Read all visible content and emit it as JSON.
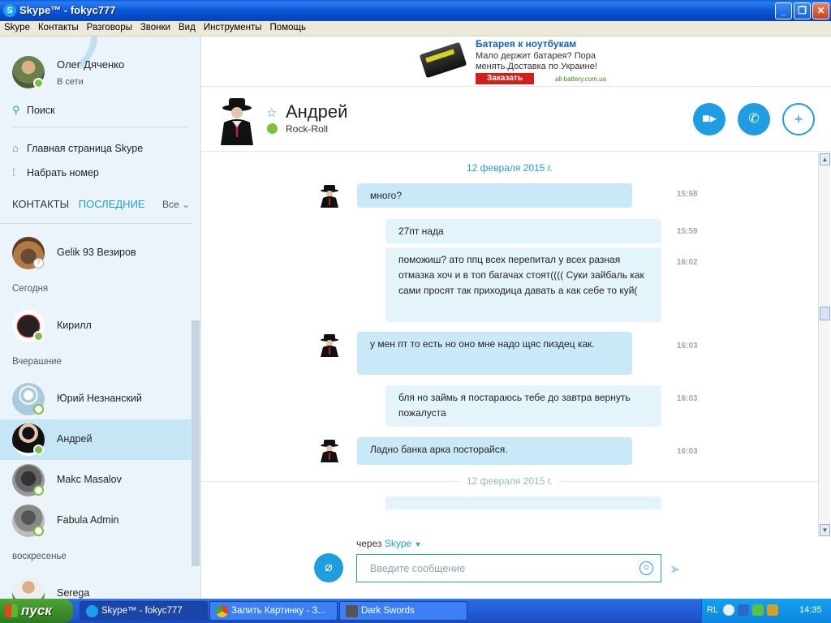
{
  "window": {
    "title": "Skype™ - fokyc777",
    "app_icon": "S"
  },
  "menu": [
    "Skype",
    "Контакты",
    "Разговоры",
    "Звонки",
    "Вид",
    "Инструменты",
    "Помощь"
  ],
  "profile": {
    "name": "Олег Дяченко",
    "status": "В сети"
  },
  "sidebar": {
    "search": "Поиск",
    "home": "Главная страница Skype",
    "dial": "Набрать номер",
    "tabs": {
      "contacts": "КОНТАКТЫ",
      "recent": "ПОСЛЕДНИЕ",
      "filter": "Все"
    }
  },
  "contacts": [
    {
      "name": "Gelik 93 Везиров",
      "status": "unknown"
    },
    {
      "section": "Сегодня"
    },
    {
      "name": "Кирилл",
      "status": "online"
    },
    {
      "section": "Вчерашние"
    },
    {
      "name": "Юрий Незнанский",
      "status": "offline"
    },
    {
      "name": "Андрей",
      "status": "online",
      "selected": true
    },
    {
      "name": "Makc Masalov",
      "status": "offline"
    },
    {
      "name": "Fabula Admin",
      "status": "offline"
    },
    {
      "section": "воскресенье"
    },
    {
      "name": "Serega",
      "status": "online"
    }
  ],
  "ad": {
    "headline": "Батарея к ноутбукам",
    "body": "Мало держит батарея? Пора менять.Доставка по Украине!",
    "button": "Заказать",
    "site": "all-battery.com.ua"
  },
  "chat": {
    "name": "Андрей",
    "mood": "Rock-Roll",
    "date_top": "12 февраля 2015 г.",
    "date_bottom": "12 февраля 2015 г.",
    "messages": [
      {
        "dir": "in",
        "text": "много?",
        "time": "15:58"
      },
      {
        "dir": "out",
        "text": "27пт нада",
        "time": "15:59"
      },
      {
        "dir": "out",
        "text": "поможиш? ато ппц всех перепитал у всех разная отмазка хоч и в топ багачах стоят(((( Суки зайбаль как сами просят так приходица давать а как себе то куй(",
        "time": "16:02"
      },
      {
        "dir": "in",
        "text": "у мен пт то есть но оно мне надо щяс пиздец как.",
        "time": "16:03"
      },
      {
        "dir": "out",
        "text": "бля но займь я постараюсь тебе до завтра вернуть пожалуста",
        "time": "16:03"
      },
      {
        "dir": "in",
        "text": "Ладно банка арка посторайся.",
        "time": "16:03"
      }
    ]
  },
  "compose": {
    "via_prefix": "через",
    "via_service": "Skype",
    "placeholder": "Введите сообщение"
  },
  "taskbar": {
    "start": "пуск",
    "tasks": [
      "Skype™ - fokyc777",
      "Залить Картинку - З...",
      "Dark Swords"
    ],
    "lang": "RL",
    "clock": "14:35"
  },
  "colors": {
    "accent": "#1e9de0",
    "online": "#7ac142",
    "sidebar_bg": "#eaf4fa"
  }
}
